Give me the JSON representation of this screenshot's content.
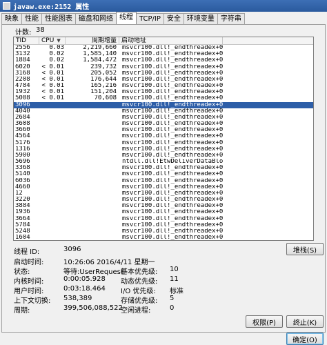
{
  "window": {
    "title": "javaw.exe:2152 属性"
  },
  "tabs": [
    "映象",
    "性能",
    "性能图表",
    "磁盘和网络",
    "线程",
    "TCP/IP",
    "安全",
    "环境变量",
    "字符串"
  ],
  "active_tab": 4,
  "thread_count": {
    "label": "计数:",
    "value": "38"
  },
  "table": {
    "columns": {
      "tid": "TID",
      "cpu": "CPU",
      "cycles": "周期增量",
      "start": "启动地址"
    },
    "rows": [
      {
        "tid": "2556",
        "cpu": "0.03",
        "cycles": "2,219,660",
        "start": "msvcr100.dll!_endthreadex+0x80"
      },
      {
        "tid": "3132",
        "cpu": "0.02",
        "cycles": "1,585,140",
        "start": "msvcr100.dll!_endthreadex+0x80"
      },
      {
        "tid": "1884",
        "cpu": "0.02",
        "cycles": "1,584,472",
        "start": "msvcr100.dll!_endthreadex+0x80"
      },
      {
        "tid": "6020",
        "cpu": "< 0.01",
        "cycles": "239,732",
        "start": "msvcr100.dll!_endthreadex+0x80"
      },
      {
        "tid": "3168",
        "cpu": "< 0.01",
        "cycles": "205,052",
        "start": "msvcr100.dll!_endthreadex+0x80"
      },
      {
        "tid": "2208",
        "cpu": "< 0.01",
        "cycles": "176,644",
        "start": "msvcr100.dll!_endthreadex+0x80"
      },
      {
        "tid": "4784",
        "cpu": "< 0.01",
        "cycles": "165,216",
        "start": "msvcr100.dll!_endthreadex+0x80"
      },
      {
        "tid": "1932",
        "cpu": "< 0.01",
        "cycles": "151,204",
        "start": "msvcr100.dll!_endthreadex+0x80"
      },
      {
        "tid": "5008",
        "cpu": "< 0.01",
        "cycles": "70,608",
        "start": "msvcr100.dll!_endthreadex+0x80"
      },
      {
        "tid": "3096",
        "cpu": "",
        "cycles": "",
        "start": "msvcr100.dll!_endthreadex+0x80"
      },
      {
        "tid": "4040",
        "cpu": "",
        "cycles": "",
        "start": "msvcr100.dll!_endthreadex+0x80"
      },
      {
        "tid": "2684",
        "cpu": "",
        "cycles": "",
        "start": "msvcr100.dll!_endthreadex+0x80"
      },
      {
        "tid": "3608",
        "cpu": "",
        "cycles": "",
        "start": "msvcr100.dll!_endthreadex+0x80"
      },
      {
        "tid": "3660",
        "cpu": "",
        "cycles": "",
        "start": "msvcr100.dll!_endthreadex+0x80"
      },
      {
        "tid": "4564",
        "cpu": "",
        "cycles": "",
        "start": "msvcr100.dll!_endthreadex+0x80"
      },
      {
        "tid": "5176",
        "cpu": "",
        "cycles": "",
        "start": "msvcr100.dll!_endthreadex+0x80"
      },
      {
        "tid": "1316",
        "cpu": "",
        "cycles": "",
        "start": "msvcr100.dll!_endthreadex+0x80"
      },
      {
        "tid": "5900",
        "cpu": "",
        "cycles": "",
        "start": "msvcr100.dll!_endthreadex+0x80"
      },
      {
        "tid": "5696",
        "cpu": "",
        "cycles": "",
        "start": "ntdll.dll!EtwDeliverDataBlo..."
      },
      {
        "tid": "3368",
        "cpu": "",
        "cycles": "",
        "start": "msvcr100.dll!_endthreadex+0x80"
      },
      {
        "tid": "5140",
        "cpu": "",
        "cycles": "",
        "start": "msvcr100.dll!_endthreadex+0x80"
      },
      {
        "tid": "6036",
        "cpu": "",
        "cycles": "",
        "start": "msvcr100.dll!_endthreadex+0x80"
      },
      {
        "tid": "4660",
        "cpu": "",
        "cycles": "",
        "start": "msvcr100.dll!_endthreadex+0x80"
      },
      {
        "tid": "12",
        "cpu": "",
        "cycles": "",
        "start": "msvcr100.dll!_endthreadex+0x80"
      },
      {
        "tid": "3220",
        "cpu": "",
        "cycles": "",
        "start": "msvcr100.dll!_endthreadex+0x80"
      },
      {
        "tid": "3884",
        "cpu": "",
        "cycles": "",
        "start": "msvcr100.dll!_endthreadex+0x80"
      },
      {
        "tid": "1936",
        "cpu": "",
        "cycles": "",
        "start": "msvcr100.dll!_endthreadex+0x80"
      },
      {
        "tid": "3664",
        "cpu": "",
        "cycles": "",
        "start": "msvcr100.dll!_endthreadex+0x80"
      },
      {
        "tid": "5784",
        "cpu": "",
        "cycles": "",
        "start": "msvcr100.dll!_endthreadex+0x80"
      },
      {
        "tid": "5248",
        "cpu": "",
        "cycles": "",
        "start": "msvcr100.dll!_endthreadex+0x80"
      },
      {
        "tid": "1604",
        "cpu": "",
        "cycles": "",
        "start": "msvcr100.dll!_endthreadex+0x80"
      }
    ],
    "selected_tid": "3096"
  },
  "details": {
    "thread_id_label": "线程 ID:",
    "thread_id": "3096",
    "start_time_label": "启动时间:",
    "start_time": "10:26:06  2016/4/11 星期一",
    "state_label": "状态:",
    "state": "等待:UserRequest",
    "base_priority_label": "基本优先级:",
    "base_priority": "10",
    "kernel_time_label": "内核时间:",
    "kernel_time": "0:00:05.928",
    "dynamic_priority_label": "动态优先级:",
    "dynamic_priority": "11",
    "user_time_label": "用户时间:",
    "user_time": "0:03:18.464",
    "io_priority_label": "I/O 优先级:",
    "io_priority": "标准",
    "context_switch_label": "上下文切换:",
    "context_switch": "538,389",
    "memory_priority_label": "存储优先级:",
    "memory_priority": "5",
    "cycles_label": "周期:",
    "cycles": "399,506,088,522",
    "ideal_processor_label": "空闲进程:",
    "ideal_processor": "0"
  },
  "buttons": {
    "stack": "堆栈(S)",
    "permissions": "权限(P)",
    "kill": "终止(K)",
    "ok": "确定(O)"
  }
}
